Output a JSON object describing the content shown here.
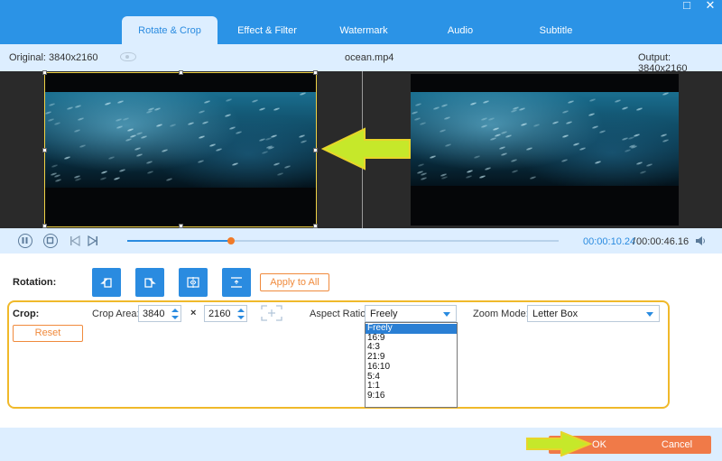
{
  "tabs": [
    {
      "label": "Rotate & Crop",
      "active": true
    },
    {
      "label": "Effect & Filter",
      "active": false
    },
    {
      "label": "Watermark",
      "active": false
    },
    {
      "label": "Audio",
      "active": false
    },
    {
      "label": "Subtitle",
      "active": false
    }
  ],
  "window": {
    "maximize_icon": "□",
    "close_icon": "✕"
  },
  "info": {
    "original": "Original: 3840x2160",
    "filename": "ocean.mp4",
    "output": "Output: 3840x2160"
  },
  "playback": {
    "current_time": "00:00:10.24",
    "separator": "/",
    "total_time": "00:00:46.16",
    "progress": 0.24
  },
  "rotation": {
    "label": "Rotation:",
    "buttons": [
      "rotate-left",
      "rotate-right",
      "flip-horizontal",
      "flip-vertical"
    ],
    "apply_label": "Apply to All"
  },
  "crop": {
    "label": "Crop:",
    "reset_label": "Reset",
    "area_label": "Crop Area:",
    "width": "3840",
    "times": "×",
    "height": "2160",
    "aspect_label": "Aspect Ratio:",
    "aspect_value": "Freely",
    "aspect_options": [
      "Freely",
      "16:9",
      "4:3",
      "21:9",
      "16:10",
      "5:4",
      "1:1",
      "9:16"
    ],
    "zoom_label": "Zoom Mode:",
    "zoom_value": "Letter Box"
  },
  "footer": {
    "ok_label": "OK",
    "cancel_label": "Cancel"
  },
  "colors": {
    "accent": "#2a8be0",
    "orange": "#f07a48",
    "highlight": "#f0b92a"
  }
}
